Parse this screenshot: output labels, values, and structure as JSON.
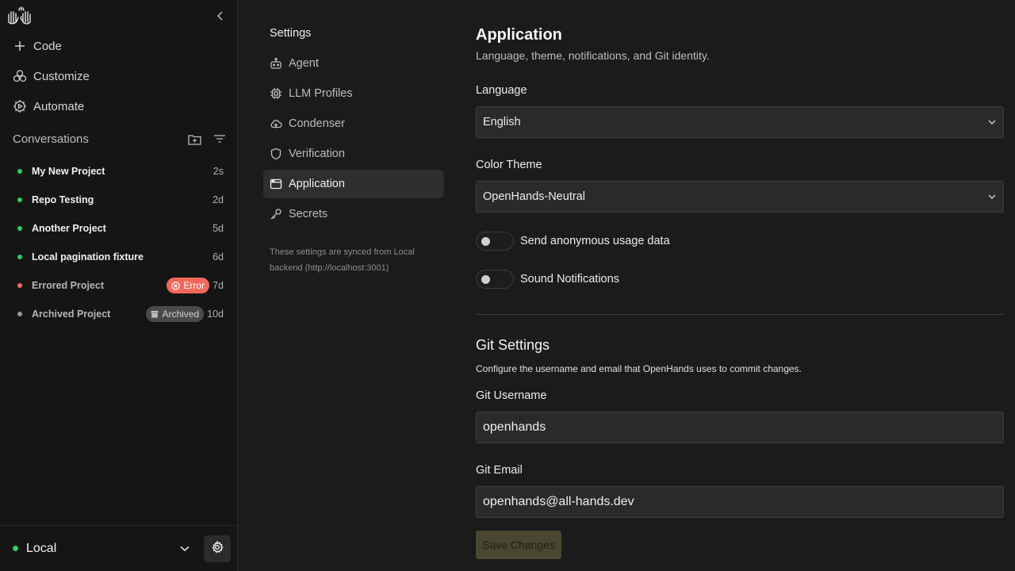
{
  "sidebar": {
    "nav": [
      {
        "label": "Code",
        "icon": "plus-icon"
      },
      {
        "label": "Customize",
        "icon": "customize-icon"
      },
      {
        "label": "Automate",
        "icon": "automate-icon"
      }
    ],
    "conversations_label": "Conversations",
    "conversations": [
      {
        "title": "My New Project",
        "age": "2s",
        "status": "active",
        "badge": ""
      },
      {
        "title": "Repo Testing",
        "age": "2d",
        "status": "active",
        "badge": ""
      },
      {
        "title": "Another Project",
        "age": "5d",
        "status": "active",
        "badge": ""
      },
      {
        "title": "Local pagination fixture",
        "age": "6d",
        "status": "active",
        "badge": ""
      },
      {
        "title": "Errored Project",
        "age": "7d",
        "status": "error",
        "badge": "Error"
      },
      {
        "title": "Archived Project",
        "age": "10d",
        "status": "archived",
        "badge": "Archived"
      }
    ],
    "backend_label": "Local"
  },
  "settings_nav": {
    "heading": "Settings",
    "items": [
      {
        "label": "Agent",
        "icon": "robot-icon"
      },
      {
        "label": "LLM Profiles",
        "icon": "chip-icon"
      },
      {
        "label": "Condenser",
        "icon": "cloud-icon"
      },
      {
        "label": "Verification",
        "icon": "shield-icon"
      },
      {
        "label": "Application",
        "icon": "window-icon",
        "active": true
      },
      {
        "label": "Secrets",
        "icon": "key-icon"
      }
    ],
    "sync_note": "These settings are synced from Local backend (http://localhost:3001)"
  },
  "application": {
    "title": "Application",
    "subtitle": "Language, theme, notifications, and Git identity.",
    "language_label": "Language",
    "language_value": "English",
    "theme_label": "Color Theme",
    "theme_value": "OpenHands-Neutral",
    "toggles": [
      {
        "label": "Send anonymous usage data",
        "on": false
      },
      {
        "label": "Sound Notifications",
        "on": false
      }
    ]
  },
  "git": {
    "title": "Git Settings",
    "subtitle": "Configure the username and email that OpenHands uses to commit changes.",
    "username_label": "Git Username",
    "username_value": "openhands",
    "email_label": "Git Email",
    "email_value": "openhands@all-hands.dev",
    "save_label": "Save Changes"
  },
  "colors": {
    "active_dot": "#2fce5c",
    "error_dot": "#f2685a",
    "archived_dot": "#9a9a9a",
    "save_button": "#4a4630"
  }
}
